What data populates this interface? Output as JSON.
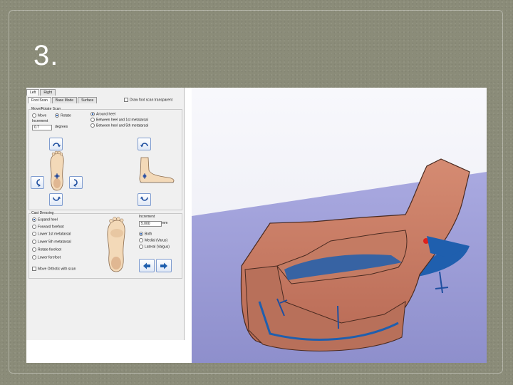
{
  "slide": {
    "title": "3."
  },
  "app": {
    "tabs_top": [
      "Left",
      "Right"
    ],
    "tabs_sub": [
      "Foot Scan",
      "Base Mode",
      "Surface"
    ],
    "draw_transparent_label": "Draw foot scan transparent",
    "move_rotate": {
      "group_label": "Move/Rotate Scan",
      "mode_options": [
        "Move",
        "Rotate"
      ],
      "mode_selected": "Rotate",
      "increment_label": "Increment",
      "increment_value": "0.7",
      "increment_unit": "degrees",
      "pivot_options": [
        "Around heel",
        "Between heel and 1st metatarsal",
        "Between heel and 5th metatarsal"
      ],
      "pivot_selected": "Around heel"
    },
    "cast_dressing": {
      "group_label": "Cast Dressing",
      "options": [
        "Expand heel",
        "Forward forefoot",
        "Lower 1st metatarsal",
        "Lower 5th metatarsal",
        "Rotate forefoot",
        "Lower forefoot"
      ],
      "selected": "Expand heel",
      "increment_label": "Increment",
      "increment_value": "5.000",
      "increment_unit": "mm",
      "side_options": [
        "Both",
        "Medial (Varus)",
        "Lateral (Valgus)"
      ],
      "side_selected": "Both",
      "move_orthotic_label": "Move Orthotic with scan"
    },
    "icons": {
      "rotate_up_left": "rotate-arrow-icon",
      "rotate_up_right": "rotate-arrow-icon",
      "rotate_left": "rotate-left-icon",
      "rotate_right": "rotate-right-icon",
      "rotate_down_left": "rotate-down-icon",
      "rotate_down_right": "rotate-down-icon",
      "arrow_left": "arrow-left-icon",
      "arrow_right": "arrow-right-icon"
    },
    "colors": {
      "viewport_floor": "#9a9bd4",
      "model_skin": "#c97a63",
      "model_blue": "#1f5fae",
      "marker_red": "#e0201c"
    }
  }
}
